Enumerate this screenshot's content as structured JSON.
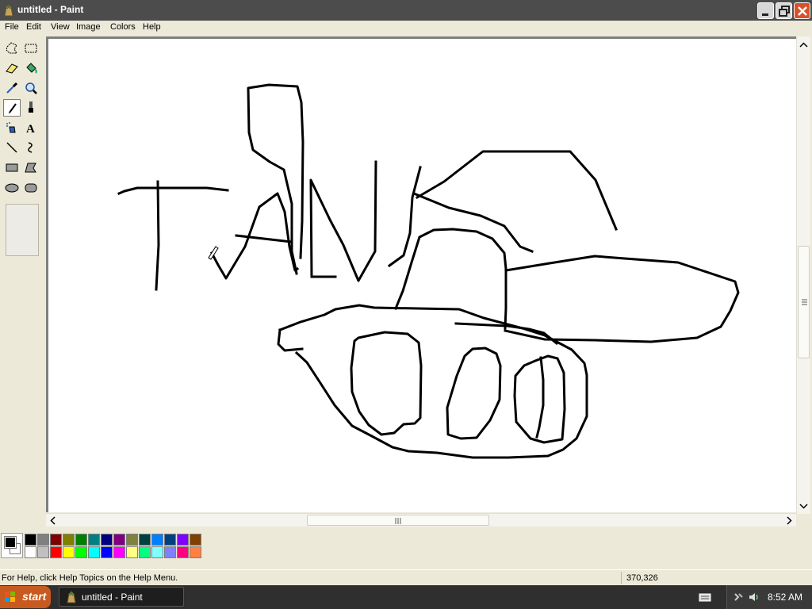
{
  "window": {
    "title": "untitled - Paint"
  },
  "menu": [
    "File",
    "Edit",
    "View",
    "Image",
    "Colors",
    "Help"
  ],
  "tools": [
    {
      "name": "free-form-select-icon"
    },
    {
      "name": "select-icon"
    },
    {
      "name": "eraser-icon"
    },
    {
      "name": "fill-bucket-icon"
    },
    {
      "name": "pick-color-icon"
    },
    {
      "name": "magnifier-icon"
    },
    {
      "name": "pencil-icon",
      "selected": true
    },
    {
      "name": "brush-icon"
    },
    {
      "name": "airbrush-icon"
    },
    {
      "name": "text-icon",
      "glyph": "A"
    },
    {
      "name": "line-icon"
    },
    {
      "name": "curve-icon"
    },
    {
      "name": "rectangle-icon"
    },
    {
      "name": "polygon-icon"
    },
    {
      "name": "ellipse-icon"
    },
    {
      "name": "rounded-rectangle-icon"
    }
  ],
  "palette": {
    "foreground": "#000000",
    "background": "#ffffff",
    "top_row": [
      "#000000",
      "#808080",
      "#800000",
      "#808000",
      "#008000",
      "#008080",
      "#000080",
      "#800080",
      "#808040",
      "#004040",
      "#0080ff",
      "#004080",
      "#8000ff",
      "#804000"
    ],
    "bottom_row": [
      "#ffffff",
      "#c0c0c0",
      "#ff0000",
      "#ffff00",
      "#00ff00",
      "#00ffff",
      "#0000ff",
      "#ff00ff",
      "#ffff80",
      "#00ff80",
      "#80ffff",
      "#8080ff",
      "#ff0080",
      "#ff8040"
    ]
  },
  "status": {
    "help_text": "For Help, click Help Topics on the Help Menu.",
    "coordinates": "370,326"
  },
  "taskbar": {
    "start_label": "start",
    "task_label": "untitled - Paint",
    "clock": "8:52 AM"
  }
}
